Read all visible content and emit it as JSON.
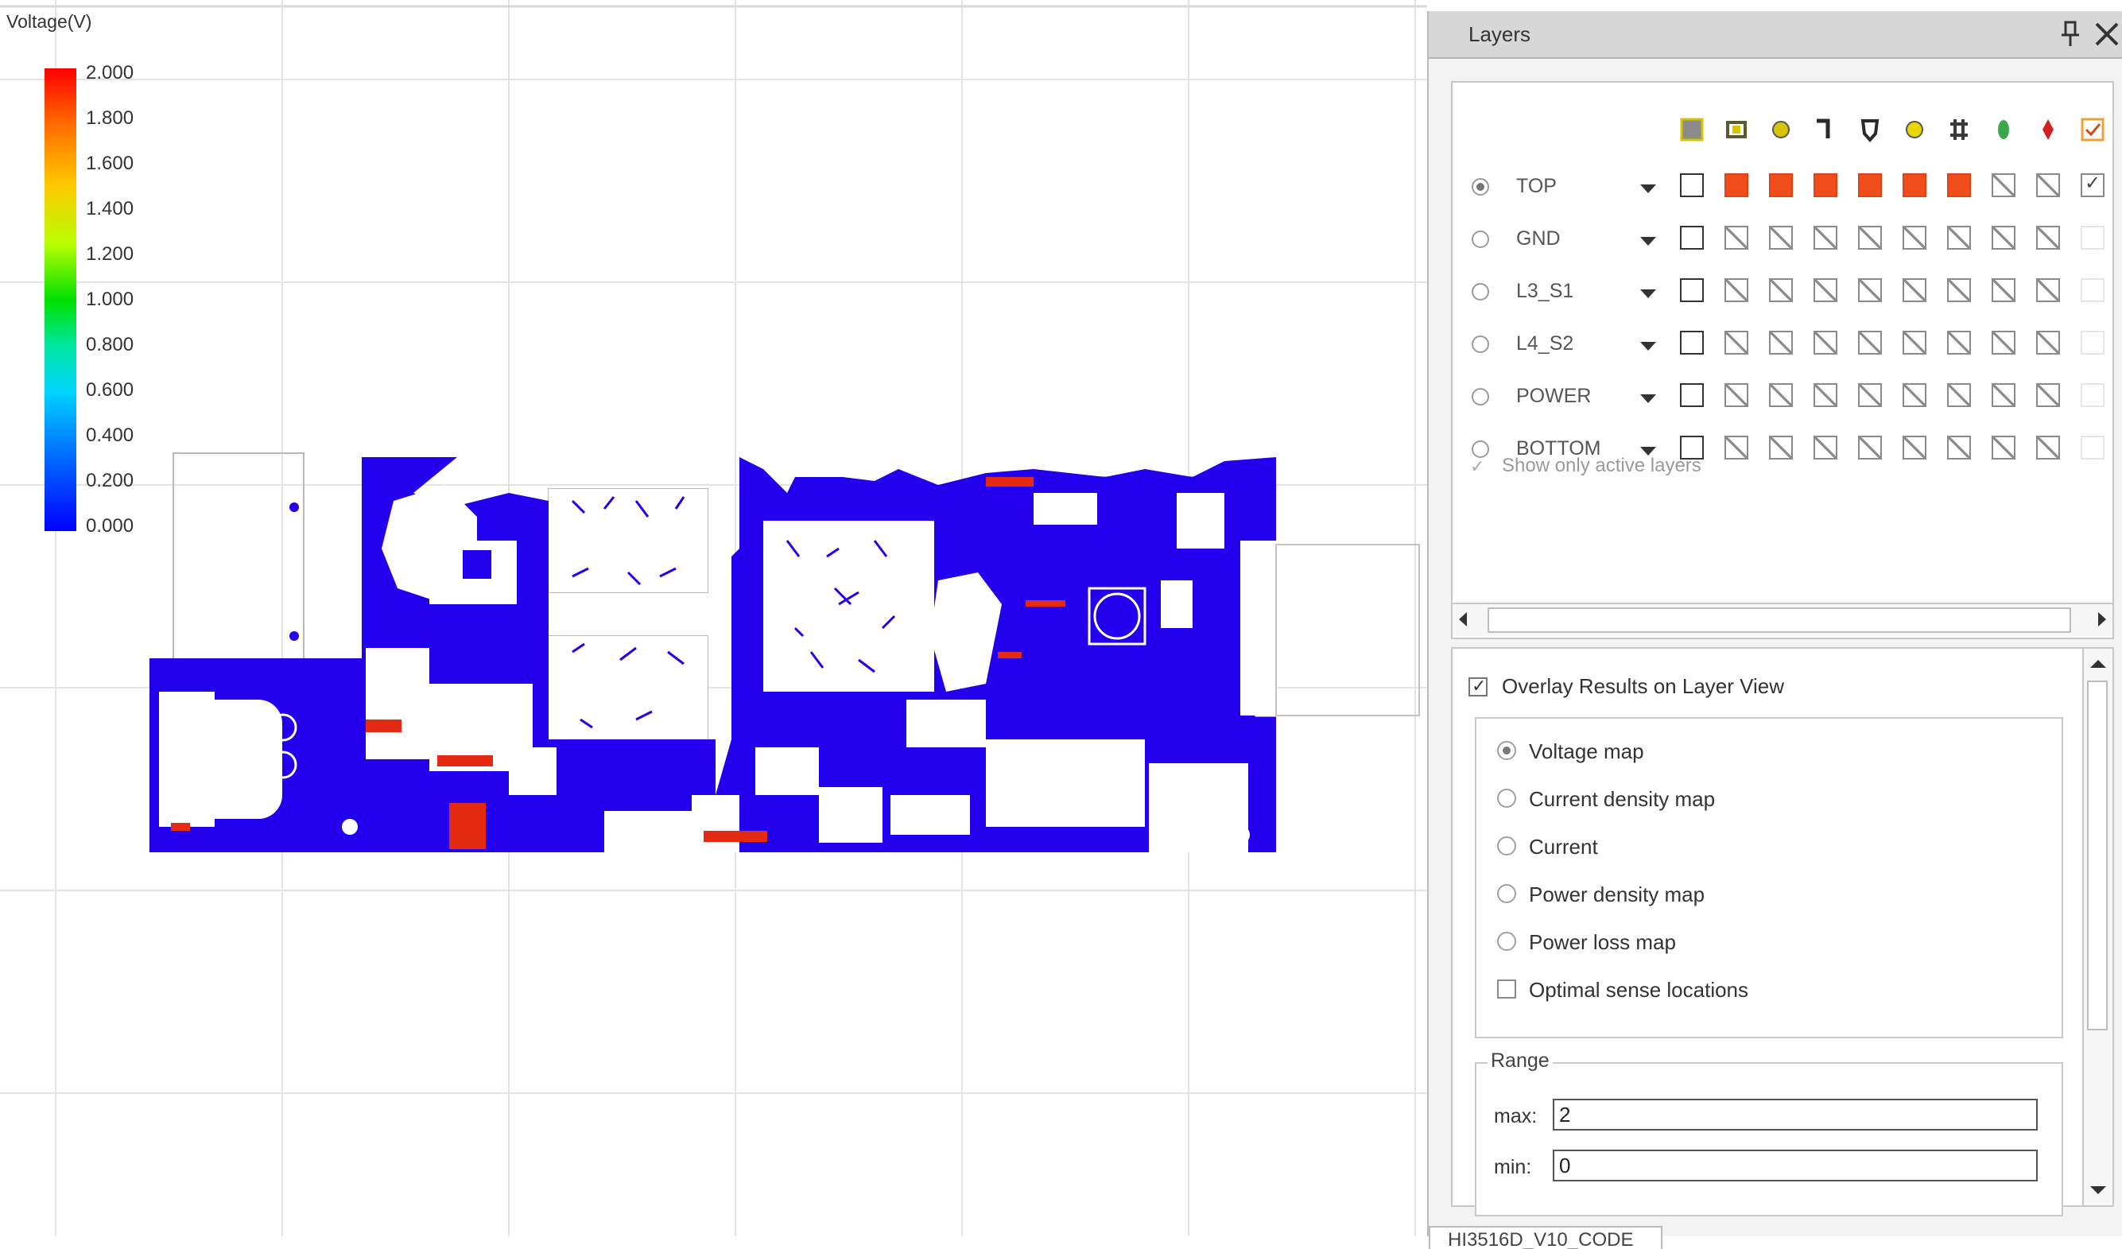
{
  "legend": {
    "title": "Voltage(V)",
    "ticks": [
      "2.000",
      "1.800",
      "1.600",
      "1.400",
      "1.200",
      "1.000",
      "0.800",
      "0.600",
      "0.400",
      "0.200",
      "0.000"
    ]
  },
  "panel": {
    "title": "Layers",
    "column_icons": [
      "plane-icon",
      "pad-icon",
      "via-icon",
      "trace-icon",
      "shape-icon",
      "drill-icon",
      "component-icon",
      "capacitor-icon",
      "net-icon",
      "check-column-icon"
    ],
    "layers": [
      {
        "name": "TOP",
        "selected": true,
        "cells": [
          "empty",
          "filled",
          "filled",
          "filled",
          "filled",
          "filled",
          "filled",
          "hatch",
          "hatch",
          "check"
        ]
      },
      {
        "name": "GND",
        "selected": false,
        "cells": [
          "empty",
          "hatch",
          "hatch",
          "hatch",
          "hatch",
          "hatch",
          "hatch",
          "hatch",
          "hatch",
          "faint"
        ]
      },
      {
        "name": "L3_S1",
        "selected": false,
        "cells": [
          "empty",
          "hatch",
          "hatch",
          "hatch",
          "hatch",
          "hatch",
          "hatch",
          "hatch",
          "hatch",
          "faint"
        ]
      },
      {
        "name": "L4_S2",
        "selected": false,
        "cells": [
          "empty",
          "hatch",
          "hatch",
          "hatch",
          "hatch",
          "hatch",
          "hatch",
          "hatch",
          "hatch",
          "faint"
        ]
      },
      {
        "name": "POWER",
        "selected": false,
        "cells": [
          "empty",
          "hatch",
          "hatch",
          "hatch",
          "hatch",
          "hatch",
          "hatch",
          "hatch",
          "hatch",
          "faint"
        ]
      },
      {
        "name": "BOTTOM",
        "selected": false,
        "cells": [
          "empty",
          "hatch",
          "hatch",
          "hatch",
          "hatch",
          "hatch",
          "hatch",
          "hatch",
          "hatch",
          "faint"
        ]
      }
    ],
    "show_only_active": "Show only active layers",
    "overlay_label": "Overlay Results on Layer View",
    "map_options": [
      {
        "label": "Voltage map",
        "type": "radio",
        "selected": true
      },
      {
        "label": "Current density map",
        "type": "radio",
        "selected": false
      },
      {
        "label": "Current",
        "type": "radio",
        "selected": false
      },
      {
        "label": "Power density map",
        "type": "radio",
        "selected": false
      },
      {
        "label": "Power loss map",
        "type": "radio",
        "selected": false
      },
      {
        "label": "Optimal sense locations",
        "type": "checkbox",
        "selected": false
      }
    ],
    "range": {
      "label": "Range",
      "max_label": "max:",
      "max_value": "2",
      "min_label": "min:",
      "min_value": "0"
    },
    "bottom_tab": "HI3516D_V10_CODE"
  },
  "colors": {
    "copper": "#2200ee",
    "hot": "#e52a12",
    "active_cell": "#f04d1a"
  }
}
